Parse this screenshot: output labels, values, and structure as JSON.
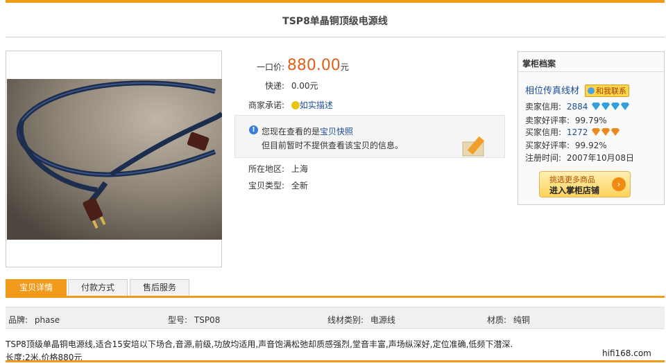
{
  "title": "TSP8单晶铜顶级电源线",
  "info": {
    "price_label": "一口价:",
    "price_value": "880.00",
    "price_unit": "元",
    "shipping_label": "快递:",
    "shipping_value": "0.00元",
    "promise_label": "商家承诺:",
    "promise_link": "如实描述",
    "location_label": "所在地区:",
    "location_value": "上海",
    "type_label": "宝贝类型:",
    "type_value": "全新"
  },
  "notice": {
    "prefix": "您现在查看的是",
    "link": "宝贝快照",
    "line2": "但目前暂时不提供查看该宝贝的信息。"
  },
  "seller": {
    "title": "掌柜档案",
    "name": "相位传真线材",
    "contact": "和我联系",
    "seller_credit_label": "卖家信用:",
    "seller_credit_value": "2884",
    "seller_rate_label": "卖家好评率:",
    "seller_rate_value": "99.79%",
    "buyer_credit_label": "买家信用:",
    "buyer_credit_value": "1272",
    "buyer_rate_label": "买家好评率:",
    "buyer_rate_value": "99.92%",
    "reg_label": "注册时间:",
    "reg_value": "2007年10月08日",
    "shop_line1": "挑选更多商品",
    "shop_line2": "进入掌柜店铺"
  },
  "tabs": [
    "宝贝详情",
    "付款方式",
    "售后服务"
  ],
  "attrs": {
    "brand_label": "品牌:",
    "brand_value": "phase",
    "model_label": "型号:",
    "model_value": "TSP08",
    "category_label": "线材类别:",
    "category_value": "电源线",
    "material_label": "材质:",
    "material_value": "纯铜"
  },
  "description": {
    "line1": "TSP8顶级单晶铜电源线,适合15安培以下场合,音源,前级,功放均适用,声音饱满松弛却质感强烈,堂音丰富,声场纵深好,定位准确,低频下潜深.",
    "line2": "长度:2米,价格880元"
  },
  "watermark": "hifi168.com",
  "colors": {
    "accent": "#f29b1b",
    "price": "#e4601a",
    "link": "#1c4d9b"
  }
}
